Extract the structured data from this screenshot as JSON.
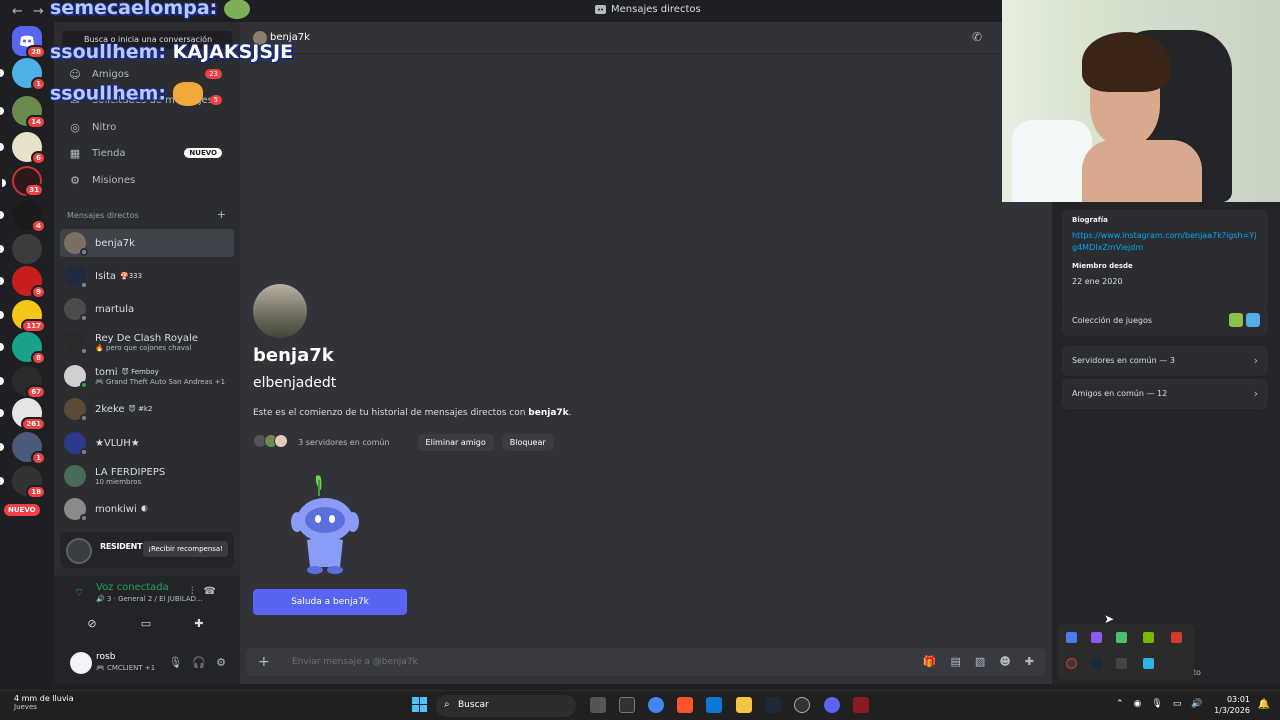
{
  "window": {
    "title": "Mensajes directos"
  },
  "overlays": {
    "chat": [
      {
        "user": "semecaelompa:",
        "text": ""
      },
      {
        "user": "ssoullhem:",
        "text": "KAJAKSJSJE"
      },
      {
        "user": "ssoullhem:",
        "text": ""
      }
    ]
  },
  "rail": {
    "badges": [
      "28",
      "1",
      "14",
      "6",
      "31",
      "4",
      "9",
      "117",
      "8",
      "67",
      "261",
      "1",
      "18",
      "NUEVO"
    ]
  },
  "sidebar": {
    "search_placeholder": "Busca o inicia una conversación",
    "nav": [
      {
        "label": "Amigos",
        "badge": "23"
      },
      {
        "label": "Solicitudes de mensajes",
        "badge": "5"
      },
      {
        "label": "Nitro"
      },
      {
        "label": "Tienda",
        "badge": "NUEVO"
      },
      {
        "label": "Misiones"
      }
    ],
    "dm_header": "Mensajes directos",
    "dms": [
      {
        "name": "benja7k",
        "tag": "",
        "sub": ""
      },
      {
        "name": "Isita",
        "tag": "🍄333",
        "sub": ""
      },
      {
        "name": "martula",
        "tag": "",
        "sub": ""
      },
      {
        "name": "Rey De Clash Royale",
        "tag": "",
        "sub": "🔥 pero que cojones chaval"
      },
      {
        "name": "tomi",
        "tag": "😈 Femboy",
        "sub": "🎮 Grand Theft Auto San Andreas +1"
      },
      {
        "name": "2keke",
        "tag": "😈 #k2",
        "sub": ""
      },
      {
        "name": "★VLUH★",
        "tag": "",
        "sub": ""
      },
      {
        "name": "LA FERDIPEPS",
        "tag": "",
        "sub": "10 miembros"
      },
      {
        "name": "monkiwi",
        "tag": "🌒",
        "sub": ""
      }
    ],
    "promo": {
      "game": "RESIDENT EVIL",
      "button": "¡Recibir recompensa!"
    },
    "voice": {
      "status": "Voz conectada",
      "channel": "🔊 3 · General 2 / El JUBILAD..."
    },
    "user": {
      "name": "rosb",
      "status": "🎮 CMCLIENT +1"
    }
  },
  "chat": {
    "header_name": "benja7k",
    "display_name": "benja7k",
    "username": "elbenjadedt",
    "intro_prefix": "Este es el comienzo de tu historial de mensajes directos con ",
    "intro_name": "benja7k",
    "intro_suffix": ".",
    "mutual_servers": "3 servidores en común",
    "remove_friend": "Eliminar amigo",
    "block": "Bloquear",
    "wave_button": "Saluda a benja7k",
    "composer_placeholder": "Enviar mensaje a @benja7k"
  },
  "profile": {
    "bio_label": "Biografía",
    "bio_link": "https://www.instagram.com/benjaa7k?igsh=Yjg4MDIxZmViejdm",
    "member_since_label": "Miembro desde",
    "member_since": "22 ene 2020",
    "games_label": "Colección de juegos",
    "servers_common": "Servidores en común — 3",
    "friends_common": "Amigos en común — 12",
    "partial_text": "eto"
  },
  "taskbar": {
    "weather": "4 mm de lluvia",
    "weather_sub": "Jueves",
    "search": "Buscar",
    "time": "03:01",
    "date": "1/3/2026"
  },
  "colors": {
    "blurple": "#5865f2",
    "online": "#23a55a",
    "badge": "#f23f43",
    "link": "#00a8fc"
  }
}
